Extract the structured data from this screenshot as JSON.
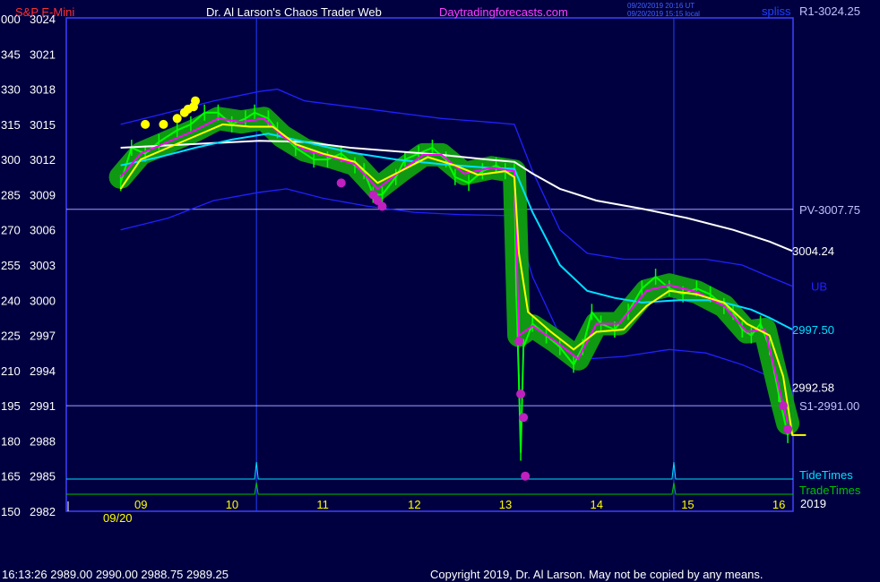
{
  "header": {
    "symbol": "S&P E-Mini",
    "title": "Dr. Al Larson's Chaos Trader Web",
    "site": "Daytradingforecasts.com",
    "timestamp_1": "09/20/2019 20:16 UT",
    "timestamp_2": "09/20/2019 15:15 local",
    "corner_label": "spliss"
  },
  "footer": {
    "quote": "16:13:26  2989.00 2990.00 2988.75 2989.25",
    "copyright": "Copyright 2019, Dr. Al Larson. May not be copied by any means."
  },
  "colors": {
    "background": "#000040",
    "frame": "#4040ff",
    "price": "#00ff00",
    "fast_avg": "#ff00ff",
    "slow_avg": "#ffff00",
    "band_avg": "#00e0ff",
    "long_avg": "#ffffff",
    "envelope": "#2020ff",
    "pivot_line": "#a0a0ff",
    "tide": "#00e0ff",
    "trade": "#00c000"
  },
  "chart_data": {
    "type": "line",
    "ylim": [
      2982,
      3024
    ],
    "y_ticks": [
      {
        "left": "000",
        "price": "3024"
      },
      {
        "left": "345",
        "price": "3021"
      },
      {
        "left": "330",
        "price": "3018"
      },
      {
        "left": "315",
        "price": "3015"
      },
      {
        "left": "300",
        "price": "3012"
      },
      {
        "left": "285",
        "price": "3009"
      },
      {
        "left": "270",
        "price": "3006"
      },
      {
        "left": "255",
        "price": "3003"
      },
      {
        "left": "240",
        "price": "3000"
      },
      {
        "left": "225",
        "price": "2997"
      },
      {
        "left": "210",
        "price": "2994"
      },
      {
        "left": "195",
        "price": "2991"
      },
      {
        "left": "180",
        "price": "2988"
      },
      {
        "left": "165",
        "price": "2985"
      },
      {
        "left": "150",
        "price": "2982"
      }
    ],
    "x_ticks": [
      "09",
      "10",
      "11",
      "12",
      "13",
      "14",
      "15",
      "16"
    ],
    "x_date_label": "09/20",
    "year_label": "2019",
    "levels": [
      {
        "label": "R1-3024.25",
        "value": 3024.25
      },
      {
        "label": "PV-3007.75",
        "value": 3007.75
      },
      {
        "label": "S1-2991.00",
        "value": 2991.0
      }
    ],
    "end_labels": [
      {
        "text": "3004.24",
        "value": 3004.24,
        "color": "#ffffff"
      },
      {
        "text": "UB",
        "value": 3001.2,
        "color": "#2020ff"
      },
      {
        "text": "2997.50",
        "value": 2997.5,
        "color": "#00e0ff"
      },
      {
        "text": "2992.58",
        "value": 2992.58,
        "color": "#ffffff"
      }
    ],
    "lower_labels": [
      "TideTimes",
      "TradeTimes"
    ],
    "time_markers": [
      10.27,
      14.85
    ],
    "price": {
      "name": "",
      "points": [
        [
          8.78,
          3010
        ],
        [
          8.9,
          3013
        ],
        [
          9.05,
          3012.5
        ],
        [
          9.2,
          3013.5
        ],
        [
          9.4,
          3014.5
        ],
        [
          9.55,
          3015
        ],
        [
          9.7,
          3016
        ],
        [
          9.85,
          3016
        ],
        [
          10.0,
          3015
        ],
        [
          10.15,
          3015.5
        ],
        [
          10.25,
          3016
        ],
        [
          10.4,
          3015.5
        ],
        [
          10.5,
          3014.5
        ],
        [
          10.7,
          3013
        ],
        [
          10.9,
          3012
        ],
        [
          11.05,
          3012
        ],
        [
          11.2,
          3012.5
        ],
        [
          11.35,
          3011.5
        ],
        [
          11.45,
          3011
        ],
        [
          11.55,
          3009
        ],
        [
          11.65,
          3009
        ],
        [
          11.8,
          3010.5
        ],
        [
          11.9,
          3012
        ],
        [
          12.05,
          3012.5
        ],
        [
          12.2,
          3013
        ],
        [
          12.35,
          3012
        ],
        [
          12.45,
          3010.5
        ],
        [
          12.6,
          3010
        ],
        [
          12.75,
          3011
        ],
        [
          12.9,
          3011.5
        ],
        [
          13.0,
          3011
        ],
        [
          13.1,
          3011
        ],
        [
          13.12,
          3001
        ],
        [
          13.15,
          2993
        ],
        [
          13.17,
          2987
        ],
        [
          13.2,
          2996
        ],
        [
          13.3,
          2998
        ],
        [
          13.45,
          2997
        ],
        [
          13.6,
          2996
        ],
        [
          13.75,
          2994.5
        ],
        [
          13.85,
          2996
        ],
        [
          13.95,
          2999
        ],
        [
          14.05,
          2998
        ],
        [
          14.2,
          2997.5
        ],
        [
          14.35,
          2999
        ],
        [
          14.5,
          3001
        ],
        [
          14.65,
          3002
        ],
        [
          14.8,
          3001
        ],
        [
          14.95,
          3000.5
        ],
        [
          15.1,
          3001
        ],
        [
          15.25,
          3000.5
        ],
        [
          15.4,
          2999.5
        ],
        [
          15.5,
          2999
        ],
        [
          15.6,
          2997.5
        ],
        [
          15.7,
          2997
        ],
        [
          15.8,
          2998
        ],
        [
          15.9,
          2996
        ],
        [
          16.0,
          2992
        ],
        [
          16.1,
          2988.5
        ]
      ]
    },
    "fast_avg": {
      "name": "",
      "points": [
        [
          8.78,
          3010.5
        ],
        [
          9.0,
          3012.5
        ],
        [
          9.3,
          3013.5
        ],
        [
          9.6,
          3014.5
        ],
        [
          9.85,
          3015.5
        ],
        [
          10.1,
          3015.2
        ],
        [
          10.35,
          3015.5
        ],
        [
          10.55,
          3014
        ],
        [
          10.8,
          3012.8
        ],
        [
          11.1,
          3012.2
        ],
        [
          11.35,
          3011.6
        ],
        [
          11.6,
          3009.5
        ],
        [
          11.85,
          3011
        ],
        [
          12.1,
          3012.4
        ],
        [
          12.3,
          3012.4
        ],
        [
          12.55,
          3010.8
        ],
        [
          12.85,
          3011.3
        ],
        [
          13.1,
          3011
        ],
        [
          13.15,
          2997
        ],
        [
          13.3,
          2997.8
        ],
        [
          13.55,
          2996.5
        ],
        [
          13.8,
          2995
        ],
        [
          14.0,
          2998
        ],
        [
          14.25,
          2998
        ],
        [
          14.55,
          3000.8
        ],
        [
          14.8,
          3001.3
        ],
        [
          15.1,
          3000.7
        ],
        [
          15.4,
          2999.5
        ],
        [
          15.65,
          2997.3
        ],
        [
          15.85,
          2997.5
        ],
        [
          16.05,
          2991
        ],
        [
          16.1,
          2989.5
        ]
      ]
    },
    "slow_avg": {
      "name": "",
      "points": [
        [
          8.78,
          3009.5
        ],
        [
          9.0,
          3012
        ],
        [
          9.3,
          3013
        ],
        [
          9.6,
          3014
        ],
        [
          9.9,
          3015
        ],
        [
          10.2,
          3014.8
        ],
        [
          10.45,
          3014.8
        ],
        [
          10.7,
          3013.3
        ],
        [
          11.0,
          3012.5
        ],
        [
          11.35,
          3011.8
        ],
        [
          11.6,
          3010
        ],
        [
          11.9,
          3011.2
        ],
        [
          12.15,
          3012.2
        ],
        [
          12.45,
          3011.5
        ],
        [
          12.7,
          3010.7
        ],
        [
          13.0,
          3011
        ],
        [
          13.1,
          3010.5
        ],
        [
          13.15,
          3004
        ],
        [
          13.25,
          2999
        ],
        [
          13.5,
          2997.3
        ],
        [
          13.75,
          2995.8
        ],
        [
          14.0,
          2997.3
        ],
        [
          14.3,
          2997.5
        ],
        [
          14.55,
          2999.5
        ],
        [
          14.8,
          3000.8
        ],
        [
          15.1,
          3000.5
        ],
        [
          15.4,
          2999.8
        ],
        [
          15.65,
          2998
        ],
        [
          15.9,
          2997
        ],
        [
          16.05,
          2993.5
        ],
        [
          16.15,
          2988.5
        ],
        [
          16.3,
          2988.5
        ]
      ]
    },
    "band_avg": {
      "name": "",
      "points": [
        [
          8.78,
          3011.5
        ],
        [
          9.2,
          3012.2
        ],
        [
          9.6,
          3013
        ],
        [
          10.0,
          3013.7
        ],
        [
          10.4,
          3014.2
        ],
        [
          10.8,
          3013.5
        ],
        [
          11.3,
          3012.6
        ],
        [
          11.8,
          3012
        ],
        [
          12.3,
          3011.6
        ],
        [
          12.8,
          3011.3
        ],
        [
          13.1,
          3011.2
        ],
        [
          13.3,
          3007.5
        ],
        [
          13.6,
          3003
        ],
        [
          13.9,
          3000.8
        ],
        [
          14.2,
          3000.2
        ],
        [
          14.5,
          2999.8
        ],
        [
          14.9,
          3000
        ],
        [
          15.3,
          3000
        ],
        [
          15.7,
          2999.2
        ],
        [
          15.9,
          2998.5
        ],
        [
          16.15,
          2997.5
        ]
      ]
    },
    "long_avg": {
      "name": "",
      "points": [
        [
          8.78,
          3013
        ],
        [
          9.3,
          3013.2
        ],
        [
          9.8,
          3013.4
        ],
        [
          10.3,
          3013.6
        ],
        [
          10.8,
          3013.5
        ],
        [
          11.3,
          3013
        ],
        [
          11.8,
          3012.7
        ],
        [
          12.3,
          3012.4
        ],
        [
          12.8,
          3012
        ],
        [
          13.1,
          3011.8
        ],
        [
          13.3,
          3010.8
        ],
        [
          13.6,
          3009.5
        ],
        [
          14.0,
          3008.5
        ],
        [
          14.5,
          3007.8
        ],
        [
          15.0,
          3007
        ],
        [
          15.5,
          3006
        ],
        [
          15.9,
          3005
        ],
        [
          16.15,
          3004.2
        ]
      ]
    },
    "upper_envelope": {
      "name": "UB",
      "points": [
        [
          8.78,
          3015
        ],
        [
          9.3,
          3016
        ],
        [
          9.8,
          3017
        ],
        [
          10.3,
          3017.8
        ],
        [
          10.5,
          3018
        ],
        [
          10.8,
          3017
        ],
        [
          11.3,
          3016.5
        ],
        [
          11.8,
          3016
        ],
        [
          12.3,
          3015.5
        ],
        [
          12.8,
          3015.2
        ],
        [
          13.1,
          3015
        ],
        [
          13.3,
          3011
        ],
        [
          13.6,
          3006
        ],
        [
          13.9,
          3004
        ],
        [
          14.3,
          3003.5
        ],
        [
          14.8,
          3003.5
        ],
        [
          15.2,
          3003.5
        ],
        [
          15.6,
          3003
        ],
        [
          15.9,
          3002
        ],
        [
          16.15,
          3001.2
        ]
      ]
    },
    "lower_envelope": {
      "name": "",
      "points": [
        [
          8.78,
          3006
        ],
        [
          9.3,
          3007
        ],
        [
          9.8,
          3008.5
        ],
        [
          10.3,
          3009.2
        ],
        [
          10.6,
          3009.5
        ],
        [
          11.0,
          3008.7
        ],
        [
          11.5,
          3008
        ],
        [
          12.0,
          3007.5
        ],
        [
          12.5,
          3007.3
        ],
        [
          13.1,
          3007.2
        ],
        [
          13.3,
          3002
        ],
        [
          13.6,
          2997
        ],
        [
          13.9,
          2995
        ],
        [
          14.3,
          2995.2
        ],
        [
          14.8,
          2995.8
        ],
        [
          15.2,
          2995.5
        ],
        [
          15.6,
          2994.5
        ],
        [
          15.9,
          2993.5
        ],
        [
          16.15,
          2992.2
        ]
      ]
    },
    "yellow_dots": [
      [
        9.05,
        3015
      ],
      [
        9.25,
        3015
      ],
      [
        9.4,
        3015.5
      ],
      [
        9.48,
        3016
      ],
      [
        9.52,
        3016.3
      ],
      [
        9.58,
        3016.5
      ],
      [
        9.6,
        3017
      ]
    ],
    "magenta_dots": [
      [
        11.2,
        3010
      ],
      [
        11.55,
        3009
      ],
      [
        11.6,
        3008.5
      ],
      [
        11.65,
        3008
      ],
      [
        13.15,
        2996.5
      ],
      [
        13.17,
        2992
      ],
      [
        13.2,
        2990
      ],
      [
        13.22,
        2985
      ],
      [
        16.05,
        2991
      ],
      [
        16.1,
        2989
      ]
    ]
  }
}
